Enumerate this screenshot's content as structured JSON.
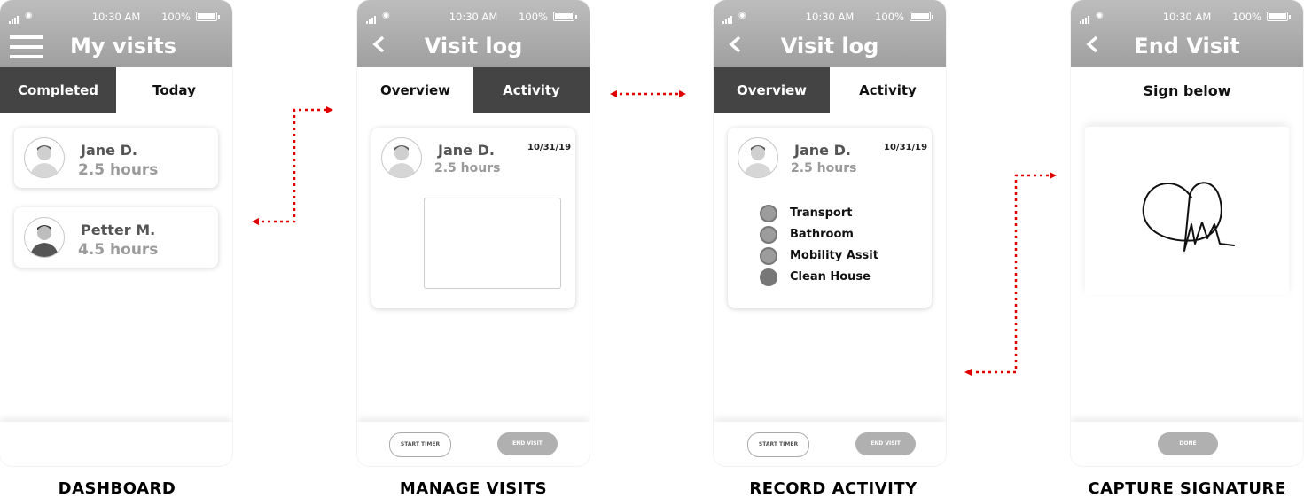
{
  "status_bar": {
    "time": "10:30 AM",
    "battery": "100%"
  },
  "screens": {
    "dashboard": {
      "title": "My visits",
      "tabs": [
        "Completed",
        "Today"
      ],
      "visits": [
        {
          "name": "Jane D.",
          "hours": "2.5 hours"
        },
        {
          "name": "Petter M.",
          "hours": "4.5 hours"
        }
      ],
      "caption": "DASHBOARD"
    },
    "manage": {
      "title": "Visit log",
      "tabs": [
        "Overview",
        "Activity"
      ],
      "visit": {
        "name": "Jane D.",
        "hours": "2.5 hours",
        "date": "10/31/19"
      },
      "buttons": {
        "start": "START TIMER",
        "end": "END VISIT"
      },
      "caption": "MANAGE VISITS"
    },
    "record": {
      "title": "Visit log",
      "tabs": [
        "Overview",
        "Activity"
      ],
      "visit": {
        "name": "Jane D.",
        "hours": "2.5 hours",
        "date": "10/31/19"
      },
      "activities": [
        "Transport",
        "Bathroom",
        "Mobility Assit",
        "Clean House"
      ],
      "buttons": {
        "start": "START TIMER",
        "end": "END VISIT"
      },
      "caption": "RECORD ACTIVITY"
    },
    "signature": {
      "title": "End Visit",
      "heading": "Sign below",
      "buttons": {
        "done": "DONE"
      },
      "caption": "CAPTURE SIGNATURE"
    }
  },
  "colors": {
    "header": "#a9a9a9",
    "active_tab": "#444444",
    "flow_arrow": "#e00000"
  },
  "icons": [
    "menu-icon",
    "back-icon",
    "avatar-icon",
    "signal-icon",
    "wifi-icon",
    "battery-icon"
  ]
}
